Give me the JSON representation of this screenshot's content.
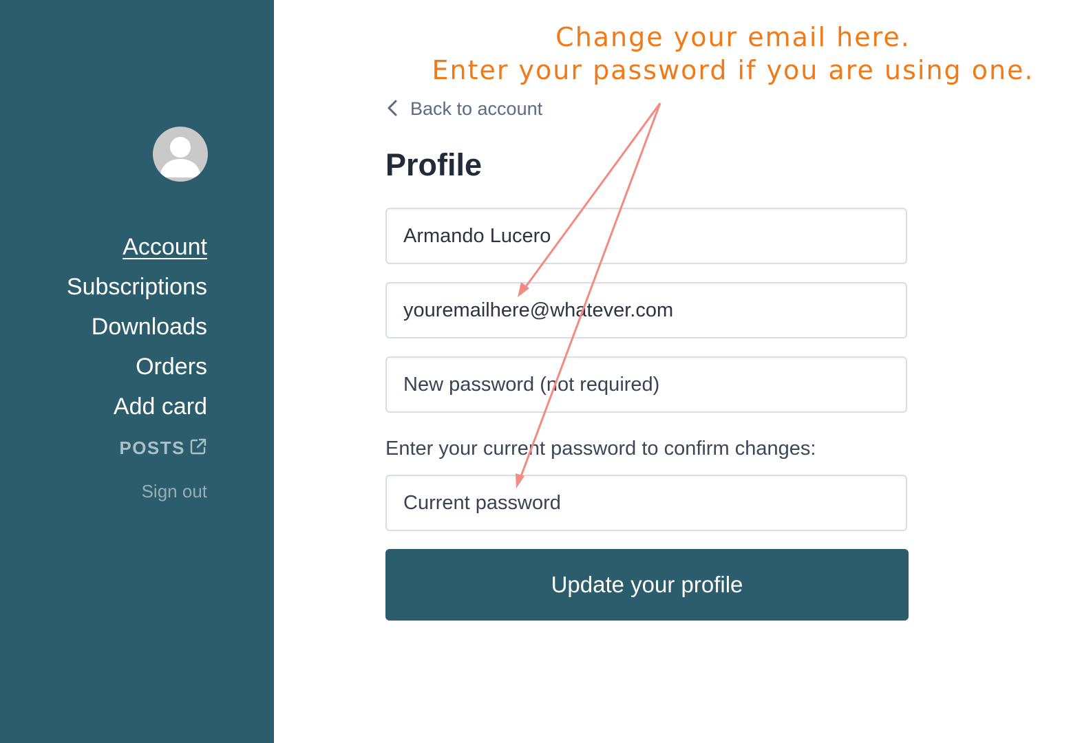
{
  "sidebar": {
    "nav": {
      "account": "Account",
      "subscriptions": "Subscriptions",
      "downloads": "Downloads",
      "orders": "Orders",
      "add_card": "Add card",
      "posts": "POSTS",
      "sign_out": "Sign out"
    },
    "posts_icon": "external-link-icon",
    "avatar_icon": "user-avatar-icon"
  },
  "annotation": {
    "line1": "Change your email here.",
    "line2": "Enter your password if you are using one."
  },
  "main": {
    "back_link": "Back to account",
    "title": "Profile",
    "name_value": "Armando Lucero",
    "email_value": "youremailhere@whatever.com",
    "new_password_placeholder": "New password (not required)",
    "confirm_label": "Enter your current password to confirm changes:",
    "current_password_placeholder": "Current password",
    "submit_label": "Update your profile"
  },
  "colors": {
    "sidebar_bg": "#2c5d6c",
    "button_bg": "#2c5d6c",
    "annotation_text": "#f07a1a",
    "annotation_arrow": "#f28b82"
  }
}
